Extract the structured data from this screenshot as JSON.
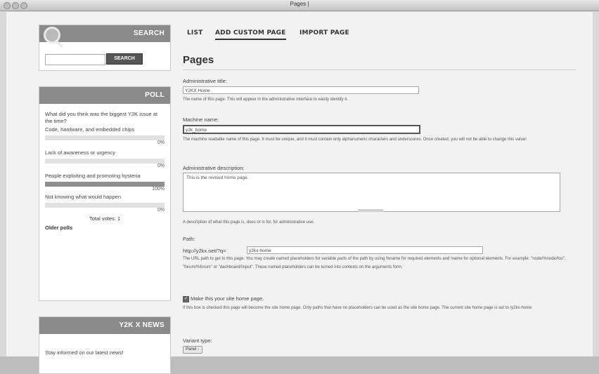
{
  "window": {
    "title": "Pages |"
  },
  "sidebar": {
    "search": {
      "title": "SEARCH",
      "button": "SEARCH",
      "placeholder": ""
    },
    "poll": {
      "title": "POLL",
      "question": "What did you think was the biggest Y2K issue at the time?",
      "choices": [
        {
          "label": "Code, hardware, and embedded chips",
          "percent": "0%",
          "fill": 0
        },
        {
          "label": "Lack of awareness or urgency",
          "percent": "0%",
          "fill": 0
        },
        {
          "label": "People exploiting and promoting hysteria",
          "percent": "100%",
          "fill": 1
        },
        {
          "label": "Not knowing what would happen",
          "percent": "0%",
          "fill": 0
        }
      ],
      "total": "Total votes: 1",
      "older": "Older polls"
    },
    "news": {
      "title": "Y2K X NEWS",
      "text": "Stay informed on our latest news!"
    }
  },
  "tabs": [
    "LIST",
    "ADD CUSTOM PAGE",
    "IMPORT PAGE"
  ],
  "form": {
    "page_title": "Pages",
    "admin_title": {
      "label": "Administrative title:",
      "value": "Y2KX Home",
      "desc": "The name of this page. This will appear in the administrative interface to easily identify it."
    },
    "machine_name": {
      "label": "Machine name:",
      "value": "y2k_home",
      "desc": "The machine readable name of this page. It must be unique, and it must contain only alphanumeric characters and underscores. Once created, you will not be able to change this value!"
    },
    "admin_desc": {
      "label": "Administrative description:",
      "value": "This is the revised home page.",
      "desc": "A description of what this page is, does or is for, for administrative use."
    },
    "path": {
      "label": "Path:",
      "prefix": "http://y2kx.net/?q=",
      "value": "y2kx-home",
      "desc": "The URL path to get to this page. You may create named placeholders for variable parts of the path by using %name for required elements and !name for optional elements. For example: \"node/%node/foo\", \"forum/%forum\" or \"dashboard/!input\". These named placeholders can be turned into contexts on the arguments form."
    },
    "homepage": {
      "label": "Make this your site home page.",
      "checked": true,
      "desc": "If this box is checked this page will become the site home page. Only paths that have no placeholders can be used as the site home page. The current site home page is set to /y2kx-home"
    },
    "variant": {
      "label": "Variant type:",
      "value": "Panel"
    }
  }
}
